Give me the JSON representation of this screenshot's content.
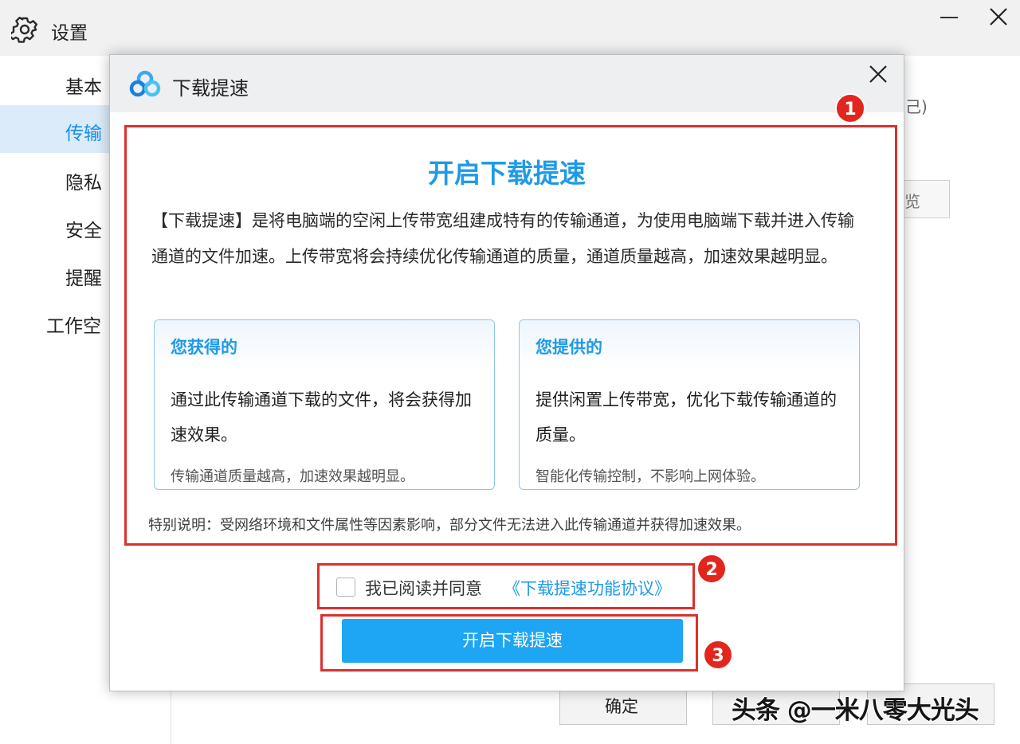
{
  "window": {
    "title": "设置",
    "icon": "gear-icon"
  },
  "sidebar": {
    "items": [
      {
        "label": "基本",
        "active": false
      },
      {
        "label": "传输",
        "active": true
      },
      {
        "label": "隐私",
        "active": false
      },
      {
        "label": "安全",
        "active": false
      },
      {
        "label": "提醒",
        "active": false
      },
      {
        "label": "工作空",
        "active": false
      }
    ]
  },
  "background": {
    "partial_text": "己)",
    "partial_box": "览"
  },
  "footer": {
    "ok_label": "确定",
    "cancel_label": "",
    "apply_label": ""
  },
  "dialog": {
    "title": "下载提速",
    "logo": "baidu-netdisk-logo-icon",
    "heading": "开启下载提速",
    "description": "【下载提速】是将电脑端的空闲上传带宽组建成特有的传输通道，为使用电脑端下载并进入传输通道的文件加速。上传带宽将会持续优化传输通道的质量，通道质量越高，加速效果越明显。",
    "cards": [
      {
        "title": "您获得的",
        "body": "通过此传输通道下载的文件，将会获得加速效果。",
        "footer": "传输通道质量越高，加速效果越明显。"
      },
      {
        "title": "您提供的",
        "body": "提供闲置上传带宽，优化下载传输通道的质量。",
        "footer": "智能化传输控制，不影响上网体验。"
      }
    ],
    "note": "特别说明：受网络环境和文件属性等因素影响，部分文件无法进入此传输通道并获得加速效果。",
    "agreement": {
      "checked": false,
      "text": "我已阅读并同意",
      "link": "《下载提速功能协议》"
    },
    "primary_button": "开启下载提速"
  },
  "annotations": {
    "badges": [
      "1",
      "2",
      "3"
    ],
    "color": "#d9312c"
  },
  "watermark": "头条 @一米八零大光头",
  "colors": {
    "accent": "#1f9ae6",
    "button": "#1ea5f3",
    "sidebar_active_bg": "#dcebf9",
    "annotation_red": "#e2261e"
  }
}
